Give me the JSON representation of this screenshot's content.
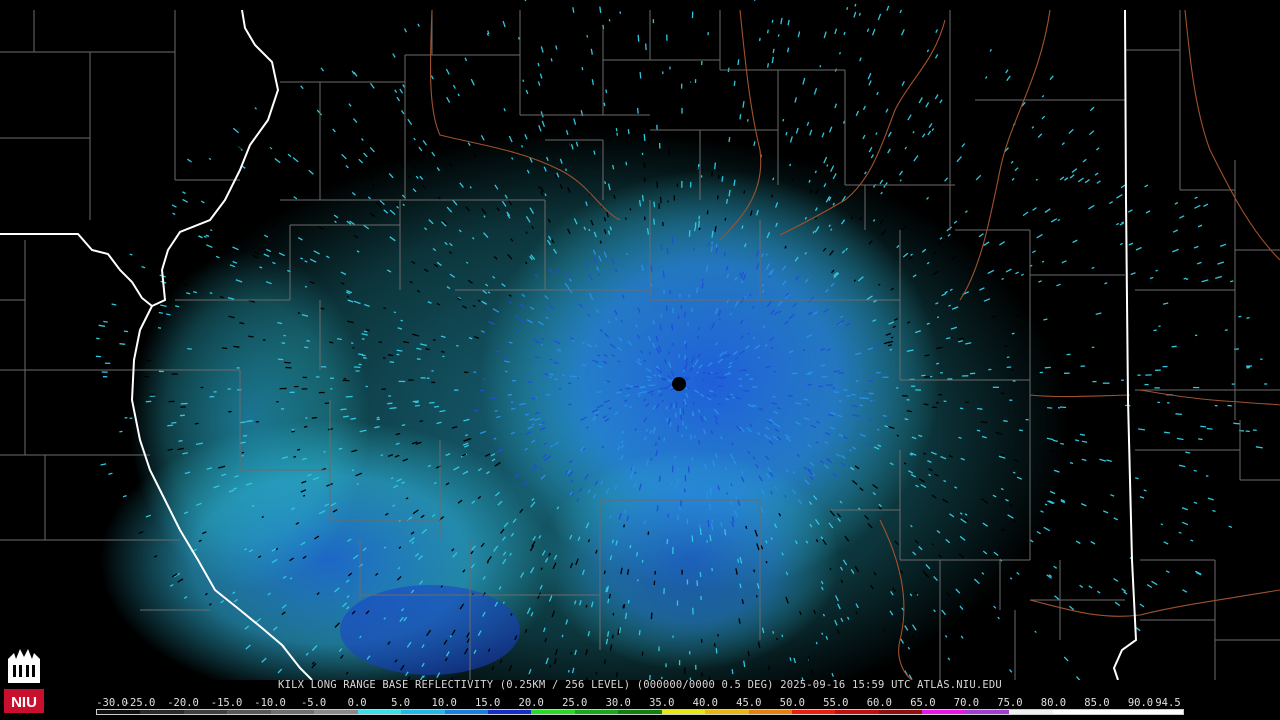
{
  "caption": "KILX LONG RANGE BASE REFLECTIVITY (0.25KM / 256 LEVEL) (000000/0000 0.5 DEG) 2025-09-16 15:59 UTC  ATLAS.NIU.EDU",
  "logo_text": "NIU",
  "legend": {
    "labels": [
      "-30.0",
      "-25.0",
      "-20.0",
      "-15.0",
      "-10.0",
      "-5.0",
      "0.0",
      "5.0",
      "10.0",
      "15.0",
      "20.0",
      "25.0",
      "30.0",
      "35.0",
      "40.0",
      "45.0",
      "50.0",
      "55.0",
      "60.0",
      "65.0",
      "70.0",
      "75.0",
      "80.0",
      "85.0",
      "90.0",
      "94.5"
    ],
    "colors": [
      "#101010",
      "#2a2a2a",
      "#404040",
      "#585858",
      "#707070",
      "#8a8a8a",
      "#3ae0e8",
      "#22b8e8",
      "#1a80e0",
      "#1430c8",
      "#2ad82a",
      "#1aa81a",
      "#108010",
      "#e8e818",
      "#e8b810",
      "#e88010",
      "#e82010",
      "#c01010",
      "#901010",
      "#e818e8",
      "#a040d0",
      "#f0f0f0",
      "#ffffff",
      "#ffffff",
      "#ffffff"
    ]
  },
  "colors": {
    "background": "#000000",
    "county_lines": "#6b6b6b",
    "state_lines": "#ffffff",
    "rivers": "#a0522d",
    "radar_site": "#000000"
  }
}
